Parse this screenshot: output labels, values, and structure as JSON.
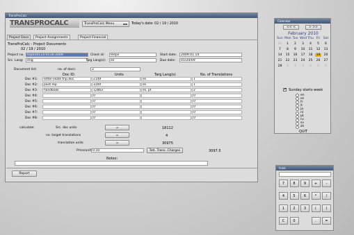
{
  "main_window": {
    "title": "TransProCalc",
    "logo_text": "TRANSPROCALC",
    "menu_label": "TransProCalc Menu",
    "date_text": "Today's date: 02 / 19 / 2010",
    "tabs": [
      "Project Docs",
      "Project Assignments",
      "Project Financial"
    ],
    "heading_line1": "TransProCalc - Project Documents",
    "heading_line2": "02 / 19 / 2010",
    "project_no_label": "Project no.",
    "project_no_value": "tep010114-0116-2009",
    "client_id_label": "Client id:",
    "client_id_value": "leeps",
    "start_date_label": "Start date:",
    "start_date_value": "2009.01.14",
    "src_lang_label": "Src. Lang:",
    "src_lang_value": "eng",
    "targ_lang_label": "Targ Lang(s):",
    "targ_lang_value": "es",
    "due_date_label": "Due date:",
    "due_date_value": "01/20/09",
    "document_list_label": "Document list:",
    "num_docs_label": "no. of docs:",
    "num_docs_value": "2",
    "col_headers": [
      "Doc ID:",
      "Units",
      "Targ Lang(s)",
      "No. of Translations"
    ],
    "rows": [
      {
        "label": "Doc #1:",
        "doc": "letter-skate trip.doc",
        "units": "2149",
        "targ": "es",
        "num": "1"
      },
      {
        "label": "Doc #2:",
        "doc": "posh lep",
        "units": "3100",
        "targ": "es",
        "num": "1"
      },
      {
        "label": "Doc #3:",
        "doc": "handbook",
        "units": "12863",
        "targ": "es, pt",
        "num": "2"
      },
      {
        "label": "Doc #4:",
        "doc": "",
        "units": "0",
        "targ": "",
        "num": "0"
      },
      {
        "label": "Doc #5:",
        "doc": "",
        "units": "0",
        "targ": "",
        "num": "0"
      },
      {
        "label": "Doc #6:",
        "doc": "",
        "units": "0",
        "targ": "",
        "num": "0"
      },
      {
        "label": "Doc #7:",
        "doc": "",
        "units": "0",
        "targ": "",
        "num": "0"
      },
      {
        "label": "Doc #8:",
        "doc": "",
        "units": "0",
        "targ": "",
        "num": "0"
      }
    ],
    "calculate_label": "calculate:",
    "src_doc_units_label": "Src. doc units",
    "src_doc_units_value": "18112",
    "no_target_label": "no. target translations",
    "no_target_value": "4",
    "translation_units_label": "translation units",
    "translation_units_value": "30975",
    "equals": "=",
    "price_unit_label": "Price/unit:",
    "price_unit_value": "0.10",
    "total_charges_button": "Totl. Trans. Charges",
    "total_charges_value": "3097.5",
    "notes_label": "Notes:",
    "report_button": "Report"
  },
  "calendar": {
    "title": "Calendar",
    "prev": "<< <",
    "next": "> >>",
    "month_year": "February 2010",
    "weekdays": [
      "Sun",
      "Mon",
      "Tue",
      "Wed",
      "Thu",
      "Fri",
      "Sat"
    ],
    "weeks": [
      [
        "31",
        "1",
        "2",
        "3",
        "4",
        "5",
        "6"
      ],
      [
        "7",
        "8",
        "9",
        "10",
        "11",
        "12",
        "13"
      ],
      [
        "14",
        "15",
        "16",
        "17",
        "18",
        "19",
        "20"
      ],
      [
        "21",
        "22",
        "23",
        "24",
        "25",
        "26",
        "27"
      ],
      [
        "28",
        "1",
        "2",
        "3",
        "4",
        "5",
        "6"
      ]
    ],
    "today": "19",
    "sunday_starts_week": "Sunday starts week",
    "languages": [
      "en",
      "es",
      "fr",
      "it",
      "ja",
      "nl",
      "pt",
      "ru",
      "sv",
      "zh"
    ],
    "quit_label": "QUIT",
    "today_color": "#f0b800"
  },
  "tcalc": {
    "title": "tcalc",
    "keys": [
      "7",
      "8",
      "9",
      "+",
      "-",
      "4",
      "5",
      "6",
      "*",
      "/",
      "1",
      "2",
      "3",
      "(",
      ")",
      "C",
      "0",
      ".",
      "="
    ]
  }
}
